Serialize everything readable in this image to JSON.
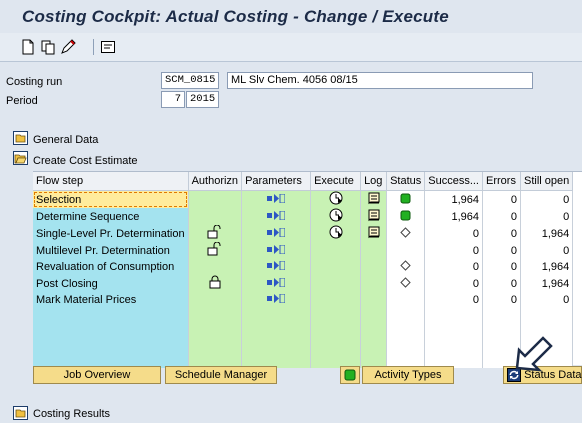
{
  "window": {
    "title": "Costing Cockpit: Actual Costing - Change / Execute"
  },
  "toolbar": {
    "icons": [
      "new-icon",
      "copy-icon",
      "edit-icon",
      "info-icon"
    ]
  },
  "header": {
    "costing_run_label": "Costing run",
    "costing_run_value": "SCM_0815",
    "costing_run_desc": "ML Slv Chem. 4056 08/15",
    "period_label": "Period",
    "period_value": "7",
    "year_value": "2015"
  },
  "sections": {
    "general_data": "General Data",
    "create_cost_estimate": "Create Cost Estimate",
    "costing_results": "Costing Results"
  },
  "grid": {
    "columns": [
      "Flow step",
      "Authorizn",
      "Parameters",
      "Execute",
      "Log",
      "Status",
      "Success...",
      "Errors",
      "Still open"
    ],
    "rows": [
      {
        "step": "Selection",
        "lock": "",
        "params": true,
        "execute": true,
        "log": true,
        "status": "green",
        "success": "1,964",
        "errors": "0",
        "open": "0"
      },
      {
        "step": "Determine Sequence",
        "lock": "",
        "params": true,
        "execute": true,
        "log": true,
        "status": "green",
        "success": "1,964",
        "errors": "0",
        "open": "0"
      },
      {
        "step": "Single-Level Pr. Determination",
        "lock": "unlocked",
        "params": true,
        "execute": true,
        "log": true,
        "status": "diamond",
        "success": "0",
        "errors": "0",
        "open": "1,964"
      },
      {
        "step": "Multilevel Pr. Determination",
        "lock": "unlocked",
        "params": true,
        "execute": false,
        "log": false,
        "status": "",
        "success": "0",
        "errors": "0",
        "open": "0"
      },
      {
        "step": "Revaluation of Consumption",
        "lock": "",
        "params": true,
        "execute": false,
        "log": false,
        "status": "diamond",
        "success": "0",
        "errors": "0",
        "open": "1,964"
      },
      {
        "step": "Post Closing",
        "lock": "locked",
        "params": true,
        "execute": false,
        "log": false,
        "status": "diamond",
        "success": "0",
        "errors": "0",
        "open": "1,964"
      },
      {
        "step": "Mark Material Prices",
        "lock": "",
        "params": true,
        "execute": false,
        "log": false,
        "status": "",
        "success": "0",
        "errors": "0",
        "open": "0"
      }
    ]
  },
  "buttons": {
    "job_overview": "Job Overview",
    "schedule_manager": "Schedule Manager",
    "activity_types": "Activity Types",
    "status_data": "Status Data"
  },
  "colors": {
    "step_bg": "#a4e3ef",
    "green_bg": "#c8f2b4",
    "status_green": "#22b022",
    "title": "#1c2b47",
    "button": "#f5dc8a"
  }
}
